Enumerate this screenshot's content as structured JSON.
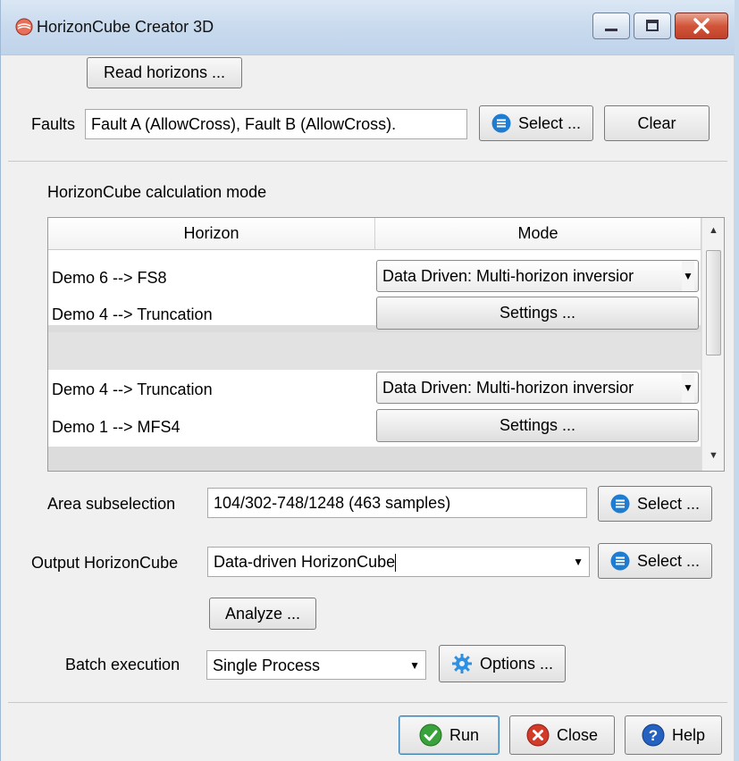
{
  "window": {
    "title": "HorizonCube Creator 3D"
  },
  "horizons": {
    "read_button": "Read horizons ..."
  },
  "faults": {
    "label": "Faults",
    "value": "Fault A (AllowCross), Fault B (AllowCross).",
    "select_button": "Select ...",
    "clear_button": "Clear"
  },
  "calc_mode": {
    "title": "HorizonCube calculation mode",
    "columns": [
      "Horizon",
      "Mode"
    ],
    "groups": [
      {
        "rows": [
          {
            "horizon": "Demo 6 --> FS8",
            "mode": "Data Driven: Multi-horizon inversior"
          },
          {
            "horizon": "Demo 4 --> Truncation",
            "mode": "Settings ..."
          }
        ]
      },
      {
        "rows": [
          {
            "horizon": "Demo 4 --> Truncation",
            "mode": "Data Driven: Multi-horizon inversior"
          },
          {
            "horizon": "Demo 1 --> MFS4",
            "mode": "Settings ..."
          }
        ]
      }
    ]
  },
  "area": {
    "label": "Area subselection",
    "value": "104/302-748/1248 (463 samples)",
    "select_button": "Select ..."
  },
  "output": {
    "label": "Output HorizonCube",
    "value": "Data-driven HorizonCube",
    "select_button": "Select ..."
  },
  "analyze_button": "Analyze ...",
  "batch": {
    "label": "Batch execution",
    "value": "Single Process",
    "options_button": "Options ..."
  },
  "footer": {
    "run": "Run",
    "close": "Close",
    "help": "Help"
  },
  "colors": {
    "accent_blue": "#1f7dd1",
    "run_green": "#3aa23a",
    "close_red": "#d23a2a",
    "help_blue": "#2561c0"
  }
}
